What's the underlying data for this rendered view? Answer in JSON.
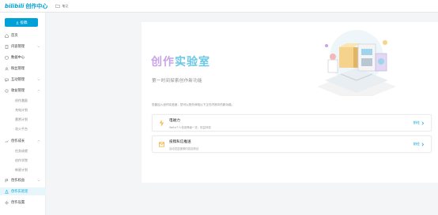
{
  "header": {
    "logo_brand": "bilibili",
    "logo_sub": "创作中心",
    "note_label": "笔记"
  },
  "sidebar": {
    "post_label": "投稿",
    "items": [
      {
        "label": "首页",
        "icon": "home-icon"
      },
      {
        "label": "内容管理",
        "icon": "document-icon",
        "chevron": true
      },
      {
        "label": "数据中心",
        "icon": "shield-icon"
      },
      {
        "label": "粉丝管理",
        "icon": "user-icon"
      },
      {
        "label": "互动管理",
        "icon": "chat-icon",
        "chevron": true
      },
      {
        "label": "收益管理",
        "icon": "coin-icon",
        "chevron": true
      }
    ],
    "income_sub": [
      "创作激励",
      "充电计划",
      "悬赏计划",
      "花火平台"
    ],
    "growth": {
      "label": "创作成长",
      "icon": "growth-icon",
      "chevron": true
    },
    "growth_sub": [
      "任务成就",
      "创作学院",
      "新星计划"
    ],
    "rights": {
      "label": "创作权益",
      "icon": "flag-icon",
      "chevron": true
    },
    "lab": {
      "label": "创作实验室",
      "icon": "lab-icon"
    },
    "settings": {
      "label": "创作设置",
      "icon": "gear-icon"
    }
  },
  "banner": {
    "title_part1": "创作",
    "title_part2": "实验室",
    "subtitle": "第一时间探索创作新功能"
  },
  "intro": "您能加入创作实验室，您可以抢先体验以下正在内测中的新功能。",
  "features": [
    {
      "title": "电磁力",
      "desc": "Weta个人信用等级一览，权益特权",
      "action": "前往",
      "icon": "magnet-icon"
    },
    {
      "title": "投稿私信推送",
      "desc": "自动发送视频内容至粉丝",
      "action": "前往",
      "icon": "mail-icon"
    }
  ],
  "colors": {
    "accent": "#00a1d6",
    "title_purple": "#c9a4e8",
    "title_blue": "#6ac7e6"
  }
}
